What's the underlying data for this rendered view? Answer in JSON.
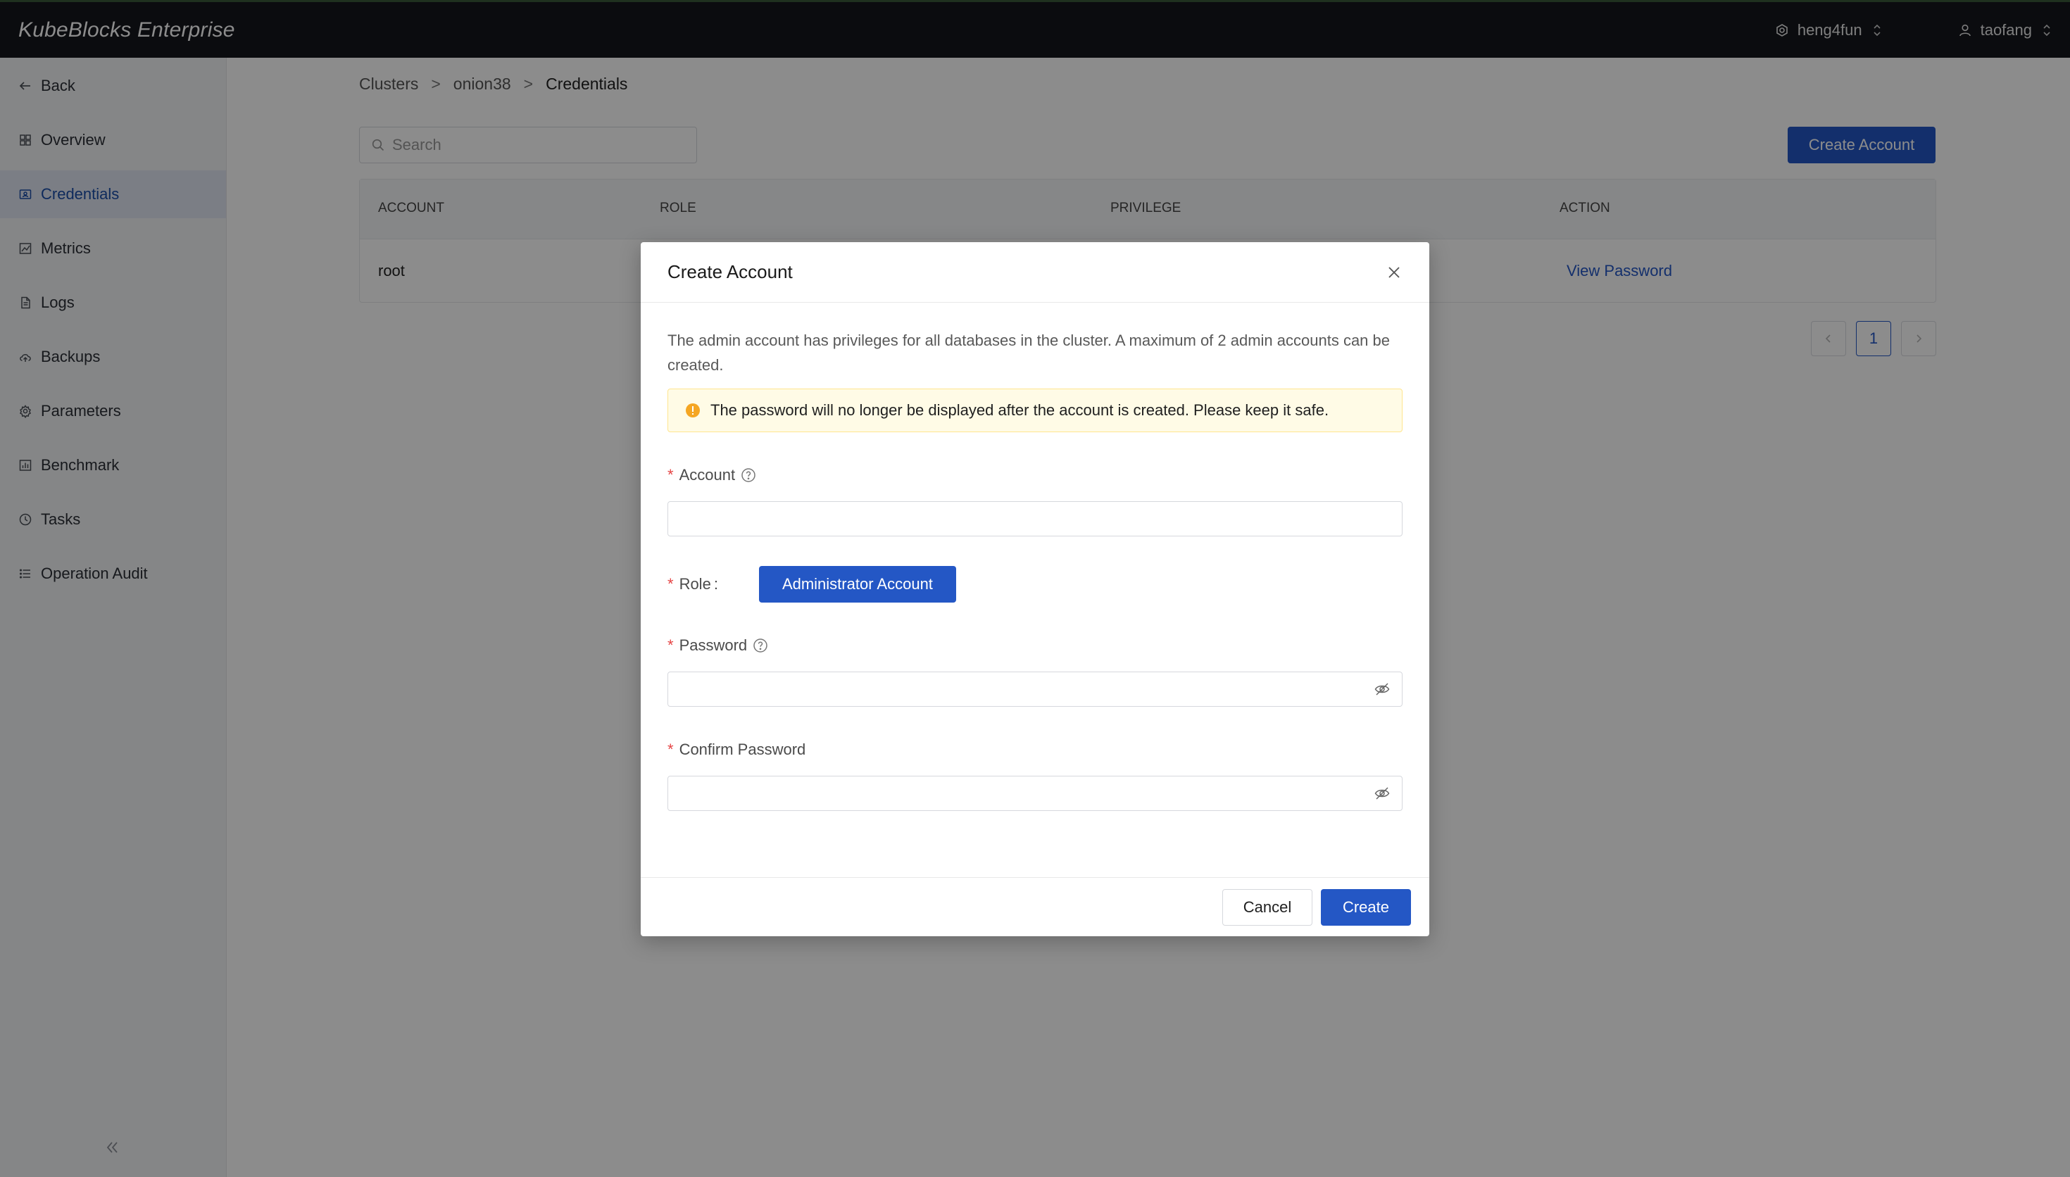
{
  "app": {
    "brand": "KubeBlocks Enterprise",
    "org": "heng4fun",
    "user": "taofang"
  },
  "sidebar": {
    "items": [
      {
        "label": "Back",
        "icon": "arrow-left-icon"
      },
      {
        "label": "Overview",
        "icon": "grid-icon"
      },
      {
        "label": "Credentials",
        "icon": "id-card-icon",
        "active": true
      },
      {
        "label": "Metrics",
        "icon": "chart-icon"
      },
      {
        "label": "Logs",
        "icon": "file-icon"
      },
      {
        "label": "Backups",
        "icon": "cloud-upload-icon"
      },
      {
        "label": "Parameters",
        "icon": "gear-icon"
      },
      {
        "label": "Benchmark",
        "icon": "bar-chart-icon"
      },
      {
        "label": "Tasks",
        "icon": "clock-icon"
      },
      {
        "label": "Operation Audit",
        "icon": "list-icon"
      }
    ]
  },
  "breadcrumb": [
    "Clusters",
    "onion38",
    "Credentials"
  ],
  "search": {
    "placeholder": "Search"
  },
  "toolbar": {
    "create_account": "Create Account"
  },
  "table": {
    "headers": [
      "ACCOUNT",
      "ROLE",
      "PRIVILEGE",
      "ACTION"
    ],
    "rows": [
      {
        "account": "root",
        "action": "View Password"
      }
    ]
  },
  "pagination": {
    "current": "1"
  },
  "modal": {
    "title": "Create Account",
    "description": "The admin account has privileges for all databases in the cluster. A maximum of 2 admin accounts can be created.",
    "warning": "The password will no longer be displayed after the account is created. Please keep it safe.",
    "account_label": "Account",
    "role_label": "Role",
    "role_value": "Administrator Account",
    "password_label": "Password",
    "confirm_label": "Confirm Password",
    "cancel": "Cancel",
    "create": "Create"
  },
  "colors": {
    "primary": "#2457c5",
    "topbar": "#15171c",
    "warning_bg": "#fffbe6",
    "required": "#e54545"
  }
}
